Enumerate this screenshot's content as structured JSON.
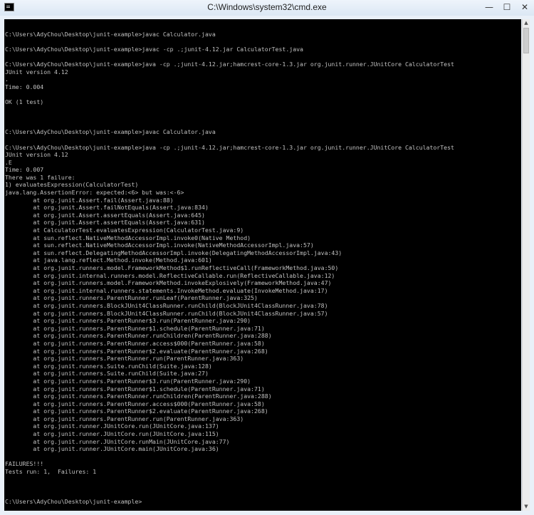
{
  "window": {
    "title": "C:\\Windows\\system32\\cmd.exe",
    "minimize_glyph": "—",
    "maximize_glyph": "☐",
    "close_glyph": "✕"
  },
  "console": {
    "lines": [
      "",
      "C:\\Users\\AdyChou\\Desktop\\junit-example>javac Calculator.java",
      "",
      "C:\\Users\\AdyChou\\Desktop\\junit-example>javac -cp .;junit-4.12.jar CalculatorTest.java",
      "",
      "C:\\Users\\AdyChou\\Desktop\\junit-example>java -cp .;junit-4.12.jar;hamcrest-core-1.3.jar org.junit.runner.JUnitCore CalculatorTest",
      "JUnit version 4.12",
      ".",
      "Time: 0.004",
      "",
      "OK (1 test)",
      "",
      "",
      "",
      "C:\\Users\\AdyChou\\Desktop\\junit-example>javac Calculator.java",
      "",
      "C:\\Users\\AdyChou\\Desktop\\junit-example>java -cp .;junit-4.12.jar;hamcrest-core-1.3.jar org.junit.runner.JUnitCore CalculatorTest",
      "JUnit version 4.12",
      ".E",
      "Time: 0.007",
      "There was 1 failure:",
      "1) evaluatesExpression(CalculatorTest)",
      "java.lang.AssertionError: expected:<6> but was:<-6>",
      "        at org.junit.Assert.fail(Assert.java:88)",
      "        at org.junit.Assert.failNotEquals(Assert.java:834)",
      "        at org.junit.Assert.assertEquals(Assert.java:645)",
      "        at org.junit.Assert.assertEquals(Assert.java:631)",
      "        at CalculatorTest.evaluatesExpression(CalculatorTest.java:9)",
      "        at sun.reflect.NativeMethodAccessorImpl.invoke0(Native Method)",
      "        at sun.reflect.NativeMethodAccessorImpl.invoke(NativeMethodAccessorImpl.java:57)",
      "        at sun.reflect.DelegatingMethodAccessorImpl.invoke(DelegatingMethodAccessorImpl.java:43)",
      "        at java.lang.reflect.Method.invoke(Method.java:601)",
      "        at org.junit.runners.model.FrameworkMethod$1.runReflectiveCall(FrameworkMethod.java:50)",
      "        at org.junit.internal.runners.model.ReflectiveCallable.run(ReflectiveCallable.java:12)",
      "        at org.junit.runners.model.FrameworkMethod.invokeExplosively(FrameworkMethod.java:47)",
      "        at org.junit.internal.runners.statements.InvokeMethod.evaluate(InvokeMethod.java:17)",
      "        at org.junit.runners.ParentRunner.runLeaf(ParentRunner.java:325)",
      "        at org.junit.runners.BlockJUnit4ClassRunner.runChild(BlockJUnit4ClassRunner.java:78)",
      "        at org.junit.runners.BlockJUnit4ClassRunner.runChild(BlockJUnit4ClassRunner.java:57)",
      "        at org.junit.runners.ParentRunner$3.run(ParentRunner.java:290)",
      "        at org.junit.runners.ParentRunner$1.schedule(ParentRunner.java:71)",
      "        at org.junit.runners.ParentRunner.runChildren(ParentRunner.java:288)",
      "        at org.junit.runners.ParentRunner.access$000(ParentRunner.java:58)",
      "        at org.junit.runners.ParentRunner$2.evaluate(ParentRunner.java:268)",
      "        at org.junit.runners.ParentRunner.run(ParentRunner.java:363)",
      "        at org.junit.runners.Suite.runChild(Suite.java:128)",
      "        at org.junit.runners.Suite.runChild(Suite.java:27)",
      "        at org.junit.runners.ParentRunner$3.run(ParentRunner.java:290)",
      "        at org.junit.runners.ParentRunner$1.schedule(ParentRunner.java:71)",
      "        at org.junit.runners.ParentRunner.runChildren(ParentRunner.java:288)",
      "        at org.junit.runners.ParentRunner.access$000(ParentRunner.java:58)",
      "        at org.junit.runners.ParentRunner$2.evaluate(ParentRunner.java:268)",
      "        at org.junit.runners.ParentRunner.run(ParentRunner.java:363)",
      "        at org.junit.runner.JUnitCore.run(JUnitCore.java:137)",
      "        at org.junit.runner.JUnitCore.run(JUnitCore.java:115)",
      "        at org.junit.runner.JUnitCore.runMain(JUnitCore.java:77)",
      "        at org.junit.runner.JUnitCore.main(JUnitCore.java:36)",
      "",
      "FAILURES!!!",
      "Tests run: 1,  Failures: 1",
      "",
      "",
      "",
      "C:\\Users\\AdyChou\\Desktop\\junit-example>"
    ]
  },
  "scrollbar": {
    "up_glyph": "▲",
    "down_glyph": "▼"
  }
}
